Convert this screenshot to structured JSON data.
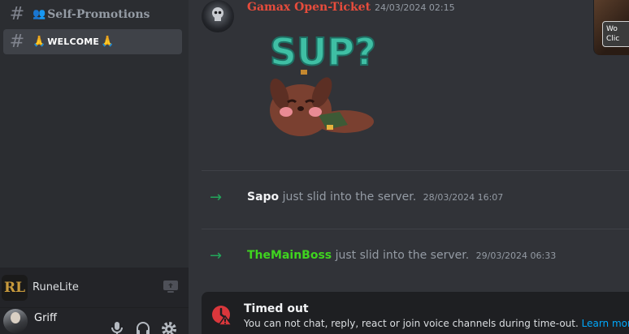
{
  "sidebar": {
    "channels": [
      {
        "emoji": "👥",
        "label": "Self-Promotions",
        "active": false
      },
      {
        "emoji": "🙏",
        "label": "WELCOME",
        "emoji_after": "🙏",
        "active": true
      }
    ],
    "activity": {
      "app_name": "RuneLite",
      "logo_text": "RL"
    },
    "user": {
      "name": "Griff"
    }
  },
  "message": {
    "author": "Gamax Open-Ticket",
    "author_color": "#e74c3c",
    "timestamp": "24/03/2024 02:15",
    "sticker_text": "SUP?"
  },
  "system_messages": [
    {
      "user": "Sapo",
      "user_color": "#f2f3f5",
      "text": "just slid into the server.",
      "timestamp": "28/03/2024 16:07"
    },
    {
      "user": "TheMainBoss",
      "user_color": "#3fd41f",
      "text": "just slid into the server.",
      "timestamp": "29/03/2024 06:33"
    }
  ],
  "timeout_banner": {
    "title": "Timed out",
    "body": "You can not chat, reply, react or join voice channels during time-out.",
    "link": "Learn more"
  },
  "thumbnail": {
    "button_line1": "Wo",
    "button_line2": "Clic"
  },
  "colors": {
    "accent_green": "#23a55a",
    "link": "#00a8fc",
    "danger": "#da373c"
  }
}
